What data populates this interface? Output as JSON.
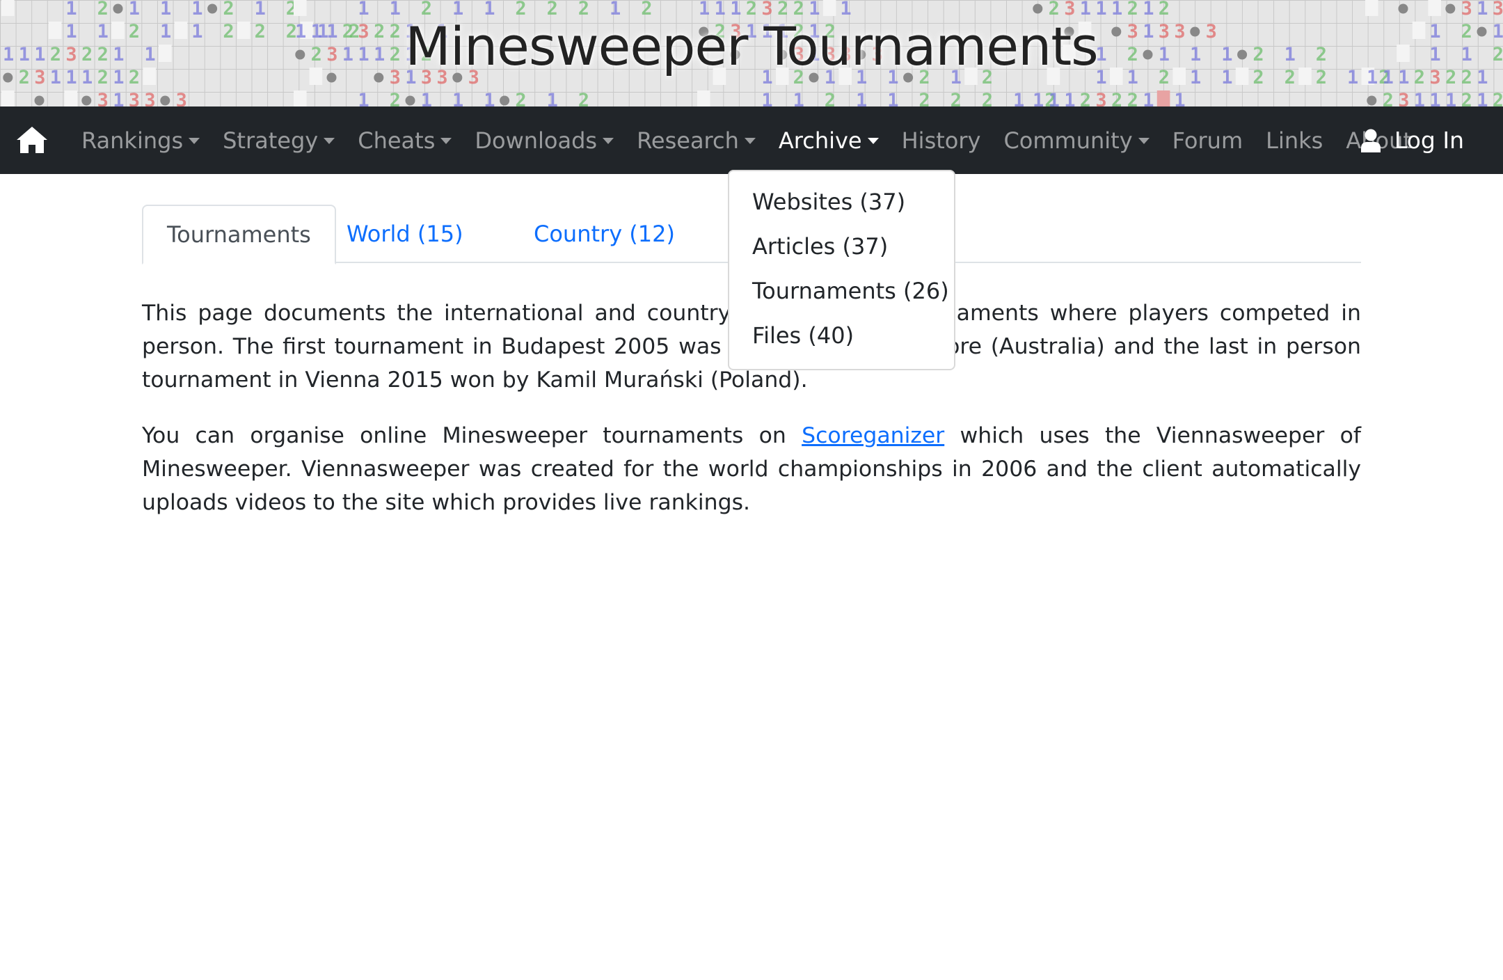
{
  "banner": {
    "title": "Minesweeper Tournaments"
  },
  "nav": {
    "items": [
      {
        "label": "Rankings",
        "dropdown": true
      },
      {
        "label": "Strategy",
        "dropdown": true
      },
      {
        "label": "Cheats",
        "dropdown": true
      },
      {
        "label": "Downloads",
        "dropdown": true
      },
      {
        "label": "Research",
        "dropdown": true
      },
      {
        "label": "Archive",
        "dropdown": true,
        "active": true
      },
      {
        "label": "History",
        "dropdown": false
      },
      {
        "label": "Community",
        "dropdown": true
      },
      {
        "label": "Forum",
        "dropdown": false
      },
      {
        "label": "Links",
        "dropdown": false
      },
      {
        "label": "About",
        "dropdown": false
      }
    ],
    "login_label": "Log In"
  },
  "archive_menu": {
    "items": [
      "Websites (37)",
      "Articles (37)",
      "Tournaments (26)",
      "Files (40)"
    ]
  },
  "tabs": [
    {
      "label": "Tournaments",
      "active": true
    },
    {
      "label": "World (15)",
      "active": false
    },
    {
      "label": "Country (12)",
      "active": false
    }
  ],
  "content": {
    "p1": "This page documents the international and country Minesweeper tournaments where players competed in person. The first tournament in Budapest 2005 was won by Damien Moore (Australia) and the last in person tournament in Vienna 2015 won by Kamil Murański (Poland).",
    "p2_before": "You can organise online Minesweeper tournaments on ",
    "p2_link": "Scoreganizer",
    "p2_after": " which uses the Viennasweeper of Minesweeper. Viennasweeper was created for the world championships in 2006 and the client automatically uploads videos to the site which provides live rankings."
  },
  "colors": {
    "navbar": "#212529",
    "link": "#0d6efd",
    "nav_text": "#8c8f92",
    "nav_active": "#ffffff",
    "tile_1": "#7b7bdc",
    "tile_2": "#6fbf6f",
    "tile_3": "#e06a6a"
  }
}
